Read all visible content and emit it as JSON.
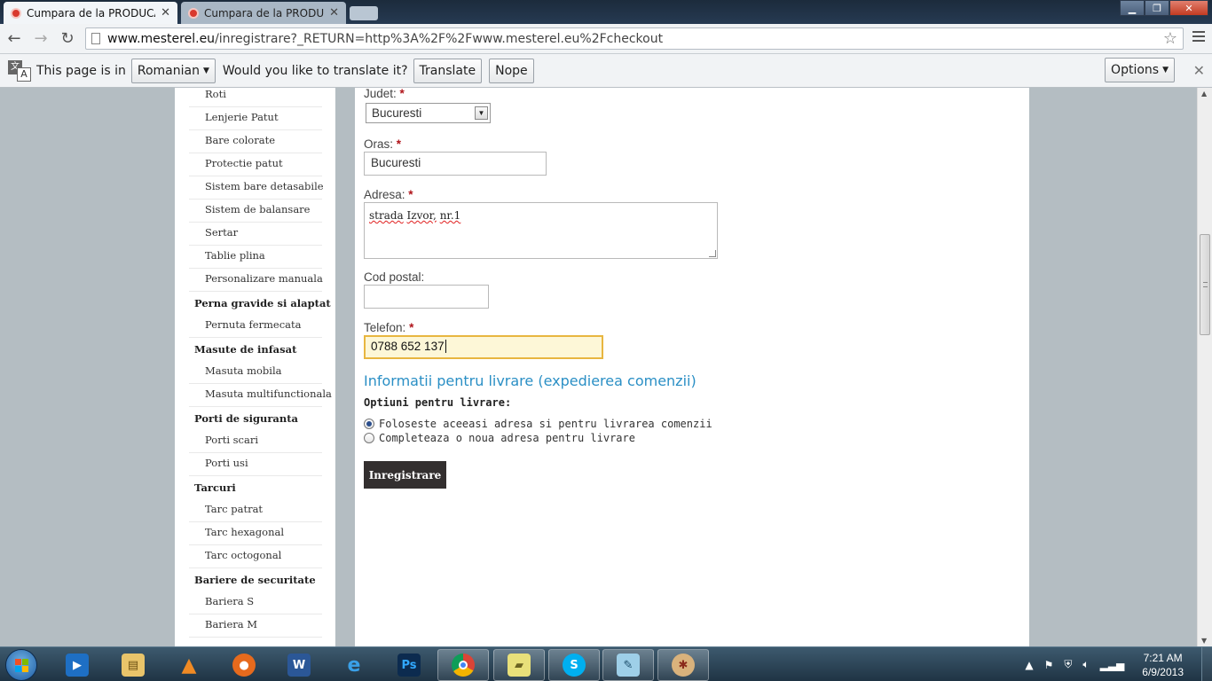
{
  "browser": {
    "tabs": [
      {
        "title": "Cumpara de la PRODUCA",
        "active": true
      },
      {
        "title": "Cumpara de la PRODUCA",
        "active": false
      }
    ],
    "url_host": "www.mesterel.eu",
    "url_path": "/inregistrare?_RETURN=http%3A%2F%2Fwww.mesterel.eu%2Fcheckout"
  },
  "translate_bar": {
    "prefix": "This page is in",
    "language": "Romanian",
    "question": "Would you like to translate it?",
    "translate_label": "Translate",
    "nope_label": "Nope",
    "options_label": "Options"
  },
  "sidebar": {
    "items": [
      {
        "label": "Roti",
        "type": "sub"
      },
      {
        "label": "Lenjerie Patut",
        "type": "sub"
      },
      {
        "label": "Bare colorate",
        "type": "sub"
      },
      {
        "label": "Protectie patut",
        "type": "sub"
      },
      {
        "label": "Sistem bare detasabile",
        "type": "sub"
      },
      {
        "label": "Sistem de balansare",
        "type": "sub"
      },
      {
        "label": "Sertar",
        "type": "sub"
      },
      {
        "label": "Tablie plina",
        "type": "sub"
      },
      {
        "label": "Personalizare manuala",
        "type": "sub"
      },
      {
        "label": "Perna gravide si alaptat",
        "type": "head"
      },
      {
        "label": "Pernuta fermecata",
        "type": "sub"
      },
      {
        "label": "Masute de infasat",
        "type": "head"
      },
      {
        "label": "Masuta mobila",
        "type": "sub"
      },
      {
        "label": "Masuta multifunctionala",
        "type": "sub"
      },
      {
        "label": "Porti de siguranta",
        "type": "head"
      },
      {
        "label": "Porti scari",
        "type": "sub"
      },
      {
        "label": "Porti usi",
        "type": "sub"
      },
      {
        "label": "Tarcuri",
        "type": "head"
      },
      {
        "label": "Tarc patrat",
        "type": "sub"
      },
      {
        "label": "Tarc hexagonal",
        "type": "sub"
      },
      {
        "label": "Tarc octogonal",
        "type": "sub"
      },
      {
        "label": "Bariere de securitate",
        "type": "head"
      },
      {
        "label": "Bariera S",
        "type": "sub"
      },
      {
        "label": "Bariera M",
        "type": "sub"
      }
    ]
  },
  "form": {
    "judet_label": "Judet:",
    "judet_value": "Bucuresti",
    "oras_label": "Oras:",
    "oras_value": "Bucuresti",
    "adresa_label": "Adresa:",
    "adresa_word1": "strada",
    "adresa_word2": "Izvor,",
    "adresa_word3": "nr.1",
    "cod_label": "Cod postal:",
    "cod_value": "",
    "telefon_label": "Telefon:",
    "telefon_value": "0788 652 137",
    "required_mark": "*",
    "delivery_title": "Informatii pentru livrare (expedierea comenzii)",
    "delivery_options_label": "Optiuni pentru livrare:",
    "option_same": "Foloseste aceeasi adresa si pentru livrarea comenzii",
    "option_new": "Completeaza o noua adresa pentru livrare",
    "selected_option": "same",
    "submit_label": "Inregistrare"
  },
  "taskbar": {
    "time": "7:21 AM",
    "date": "6/9/2013",
    "apps": [
      "media-player",
      "file-explorer",
      "vlc",
      "firefox",
      "word",
      "internet-explorer",
      "photoshop",
      "chrome",
      "notes",
      "skype",
      "notepad",
      "paint"
    ]
  },
  "colors": {
    "accent_link": "#2a8fc5",
    "required": "#b0141a",
    "submit_bg": "#332f2f",
    "focus_border": "#e8b640",
    "page_bg": "#b4bdc2"
  }
}
